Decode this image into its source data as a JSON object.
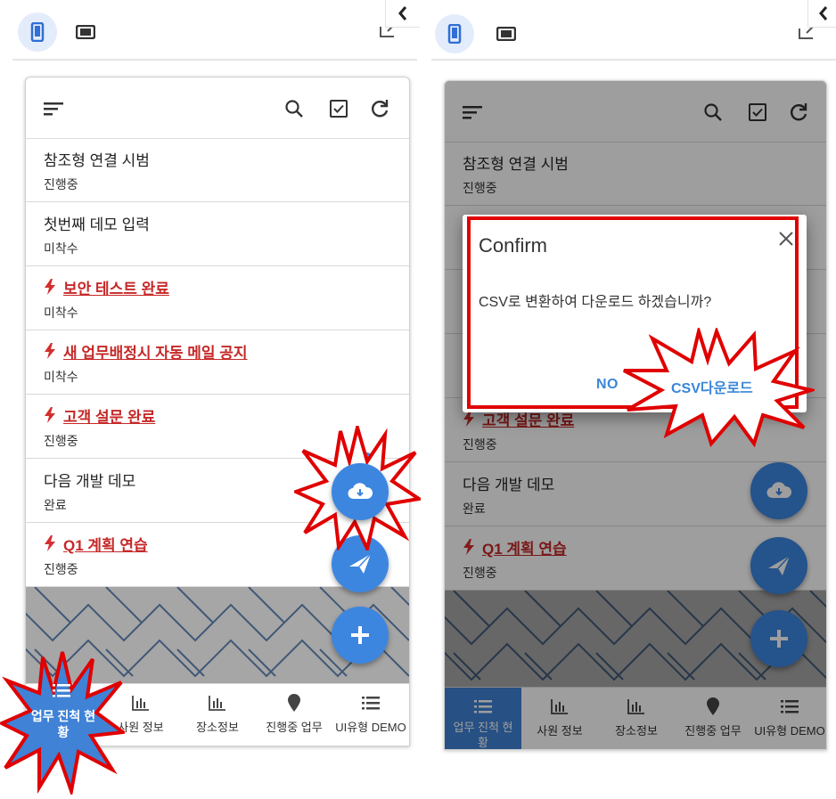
{
  "toolbar": {
    "phone_icon": "smartphone-icon",
    "tablet_icon": "tablet-icon",
    "collapse_icon": "chevron-left-icon"
  },
  "appbar": {
    "menu_icon": "sort-menu-icon",
    "search_icon": "search-icon",
    "check_icon": "checkbox-icon",
    "refresh_icon": "refresh-icon"
  },
  "tasks": [
    {
      "title": "참조형 연결 시범",
      "status": "진행중",
      "urgent": false
    },
    {
      "title": "첫번째 데모 입력",
      "status": "미착수",
      "urgent": false
    },
    {
      "title": "보안 테스트 완료",
      "status": "미착수",
      "urgent": true
    },
    {
      "title": "새 업무배정시 자동 메일 공지",
      "status": "미착수",
      "urgent": true
    },
    {
      "title": "고객 설문 완료",
      "status": "진행중",
      "urgent": true
    },
    {
      "title": "다음 개발 데모",
      "status": "완료",
      "urgent": false
    },
    {
      "title": "Q1 계획 연습",
      "status": "진행중",
      "urgent": true
    }
  ],
  "fabs": {
    "download_icon": "cloud-download-icon",
    "send_icon": "send-icon",
    "add_icon": "plus-icon"
  },
  "bottom_nav": [
    {
      "label": "업무 진척 현황",
      "icon": "list-icon",
      "active": true
    },
    {
      "label": "사원 정보",
      "icon": "bar-chart-icon",
      "active": false
    },
    {
      "label": "장소정보",
      "icon": "bar-chart-icon",
      "active": false
    },
    {
      "label": "진행중 업무",
      "icon": "location-pin-icon",
      "active": false
    },
    {
      "label": "UI유형 DEMO",
      "icon": "list-icon",
      "active": false
    }
  ],
  "left_burst_label": "업무 진척 현\n황",
  "left_nav_active_label": "업무 진척 현",
  "left_nav_active_label_2": "황",
  "dialog": {
    "title": "Confirm",
    "message": "CSV로 변환하여 다운로드 하겠습니까?",
    "no_label": "NO",
    "csv_label": "CSV다운로드"
  },
  "colors": {
    "accent": "#3d86e0",
    "urgent": "#c62828",
    "highlight": "#e00000"
  }
}
